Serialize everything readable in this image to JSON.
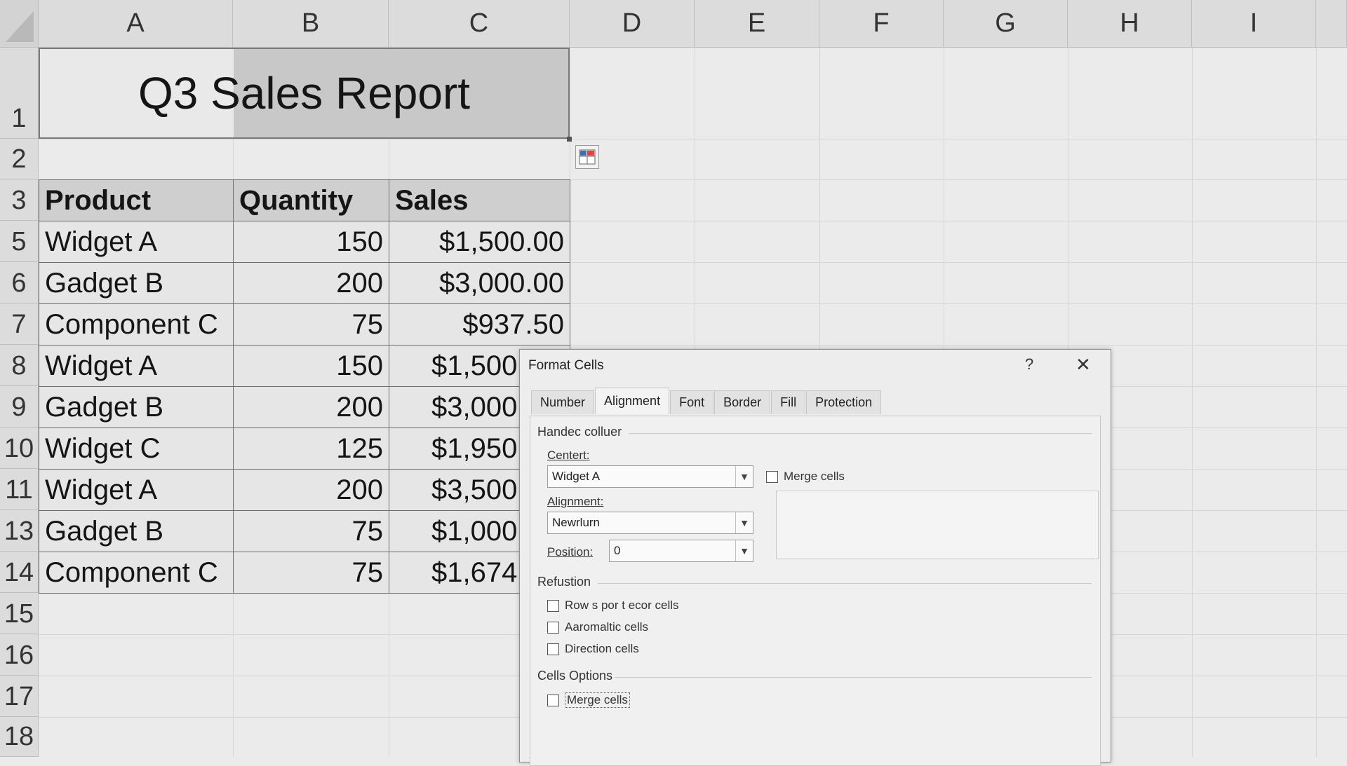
{
  "columns": [
    "A",
    "B",
    "C",
    "D",
    "E",
    "F",
    "G",
    "H",
    "I"
  ],
  "rows": [
    "1",
    "2",
    "3",
    "5",
    "6",
    "7",
    "8",
    "9",
    "10",
    "11",
    "13",
    "14",
    "15",
    "16",
    "17",
    "18"
  ],
  "title_cell": "Q3 Sales Report",
  "table": {
    "headers": [
      "Product",
      "Quantity",
      "Sales"
    ],
    "rows": [
      [
        "Widget A",
        "150",
        "$1,500.00"
      ],
      [
        "Gadget B",
        "200",
        "$3,000.00"
      ],
      [
        "Component C",
        "75",
        "$937.50"
      ],
      [
        "Widget A",
        "150",
        "$1,500"
      ],
      [
        "Gadget B",
        "200",
        "$3,000"
      ],
      [
        "Widget C",
        "125",
        "$1,950"
      ],
      [
        "Widget A",
        "200",
        "$3,500"
      ],
      [
        "Gadget B",
        "75",
        "$1,000"
      ],
      [
        "Component C",
        "75",
        "$1,674"
      ]
    ]
  },
  "dialog": {
    "title": "Format Cells",
    "help": "?",
    "close": "✕",
    "tabs": [
      "Number",
      "Alignment",
      "Font",
      "Border",
      "Fill",
      "Protection"
    ],
    "active_tab": "Alignment",
    "section1": "Handec colluer",
    "centert_label": "Centert:",
    "centert_value": "Widget A",
    "alignment_label": "Alignment:",
    "alignment_value": "Newrlurn",
    "position_label": "Position:",
    "position_value": "0",
    "merge_top": "Merge cells",
    "section2": "Refustion",
    "checks": [
      "Row s por t ecor cells",
      "Aaromaltic cells",
      "Direction cells"
    ],
    "section3": "Cells Options",
    "merge_bottom": "Merge cells"
  },
  "icons": {
    "dropdown": "chevron-down-icon",
    "quick_analysis": "quick-analysis-icon"
  }
}
